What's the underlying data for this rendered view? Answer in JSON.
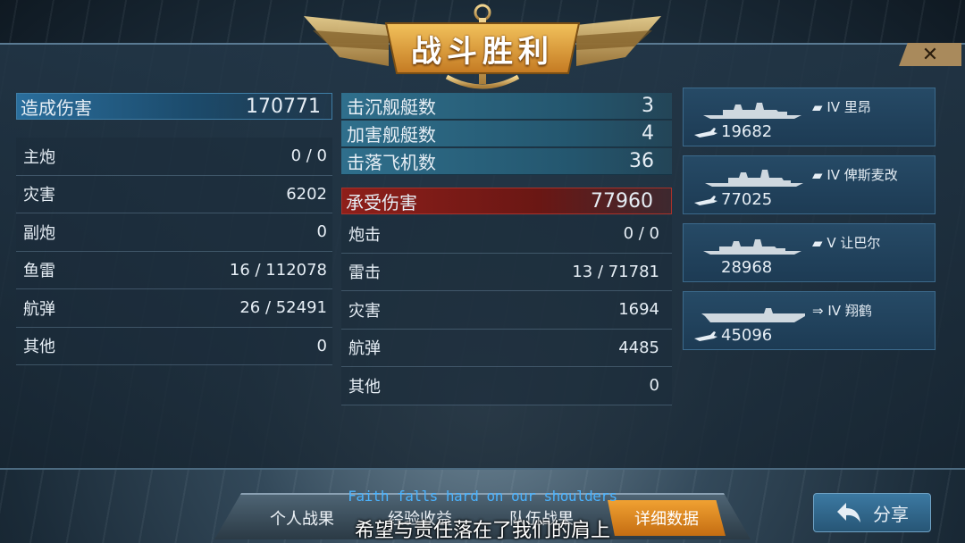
{
  "banner": {
    "title": "战斗胜利"
  },
  "close": {
    "glyph": "✕"
  },
  "damage_dealt": {
    "label": "造成伤害",
    "total": "170771",
    "rows": [
      {
        "label": "主炮",
        "value": "0 / 0"
      },
      {
        "label": "灾害",
        "value": "6202"
      },
      {
        "label": "副炮",
        "value": "0"
      },
      {
        "label": "鱼雷",
        "value": "16 / 112078"
      },
      {
        "label": "航弹",
        "value": "26 / 52491"
      },
      {
        "label": "其他",
        "value": "0"
      }
    ]
  },
  "kills": [
    {
      "label": "击沉舰艇数",
      "value": "3"
    },
    {
      "label": "加害舰艇数",
      "value": "4"
    },
    {
      "label": "击落飞机数",
      "value": "36"
    }
  ],
  "damage_taken": {
    "label": "承受伤害",
    "total": "77960",
    "rows": [
      {
        "label": "炮击",
        "value": "0 / 0"
      },
      {
        "label": "雷击",
        "value": "13 / 71781"
      },
      {
        "label": "灾害",
        "value": "1694"
      },
      {
        "label": "航弹",
        "value": "4485"
      },
      {
        "label": "其他",
        "value": "0"
      }
    ]
  },
  "ships": [
    {
      "tier": "IV",
      "name": "里昂",
      "damage": "19682",
      "icon": "torpedo-plane-icon"
    },
    {
      "tier": "IV",
      "name": "俾斯麦改",
      "damage": "77025",
      "icon": "torpedo-plane-icon"
    },
    {
      "tier": "V",
      "name": "让巴尔",
      "damage": "28968",
      "icon": "none"
    },
    {
      "tier": "IV",
      "name": "翔鹤",
      "damage": "45096",
      "icon": "torpedo-plane-icon"
    }
  ],
  "tabs": [
    {
      "label": "个人战果"
    },
    {
      "label": "经验收益"
    },
    {
      "label": "队伍战果"
    },
    {
      "label": "详细数据",
      "active": true
    }
  ],
  "share": {
    "label": "分享"
  },
  "subtitle": {
    "en": "Faith falls hard on our shoulders",
    "zh": "希望与责任落在了我们的肩上"
  },
  "colors": {
    "accent_orange": "#e88a1e",
    "panel_blue": "#2a6e9c",
    "damage_red": "#8e1f1a",
    "gold": "#c9a25a"
  }
}
